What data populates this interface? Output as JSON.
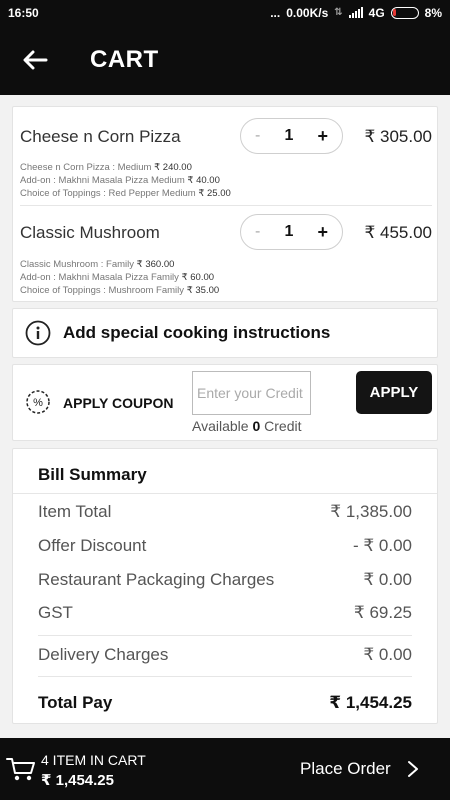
{
  "status_bar": {
    "time": "16:50",
    "dots": "...",
    "network_speed": "0.00K/s",
    "network_type": "4G",
    "battery": "8%"
  },
  "app_bar": {
    "title": "CART"
  },
  "items": [
    {
      "name": "Cheese n Corn Pizza",
      "qty": "1",
      "minus": "-",
      "plus": "+",
      "price": "₹ 305.00",
      "details": [
        {
          "label": "Cheese n Corn Pizza : Medium",
          "price": "₹ 240.00"
        },
        {
          "label": "Add-on : Makhni Masala Pizza Medium",
          "price": "₹ 40.00"
        },
        {
          "label": "Choice of Toppings : Red Pepper Medium",
          "price": "₹ 25.00"
        }
      ]
    },
    {
      "name": "Classic Mushroom",
      "qty": "1",
      "minus": "-",
      "plus": "+",
      "price": "₹ 455.00",
      "details": [
        {
          "label": "Classic Mushroom : Family",
          "price": "₹ 360.00"
        },
        {
          "label": "Add-on : Makhni Masala Pizza Family",
          "price": "₹ 60.00"
        },
        {
          "label": "Choice of Toppings : Mushroom Family",
          "price": "₹ 35.00"
        }
      ]
    }
  ],
  "instructions": {
    "label": "Add special cooking instructions"
  },
  "coupon": {
    "label": "APPLY COUPON",
    "placeholder": "Enter your Credit",
    "available_prefix": "Available",
    "available_value": "0",
    "available_suffix": "Credit",
    "apply_label": "APPLY"
  },
  "bill": {
    "title": "Bill Summary",
    "rows": [
      {
        "label": "Item Total",
        "value": "₹ 1,385.00"
      },
      {
        "label": "Offer Discount",
        "value": "- ₹ 0.00"
      },
      {
        "label": "Restaurant Packaging Charges",
        "value": "₹ 0.00"
      },
      {
        "label": "GST",
        "value": "₹ 69.25"
      },
      {
        "label": "Delivery Charges",
        "value": "₹ 0.00"
      }
    ],
    "total_label": "Total Pay",
    "total_value": "₹ 1,454.25"
  },
  "bottom_bar": {
    "cart_count": "4 ITEM IN CART",
    "cart_total": "₹ 1,454.25",
    "place_order": "Place Order"
  }
}
